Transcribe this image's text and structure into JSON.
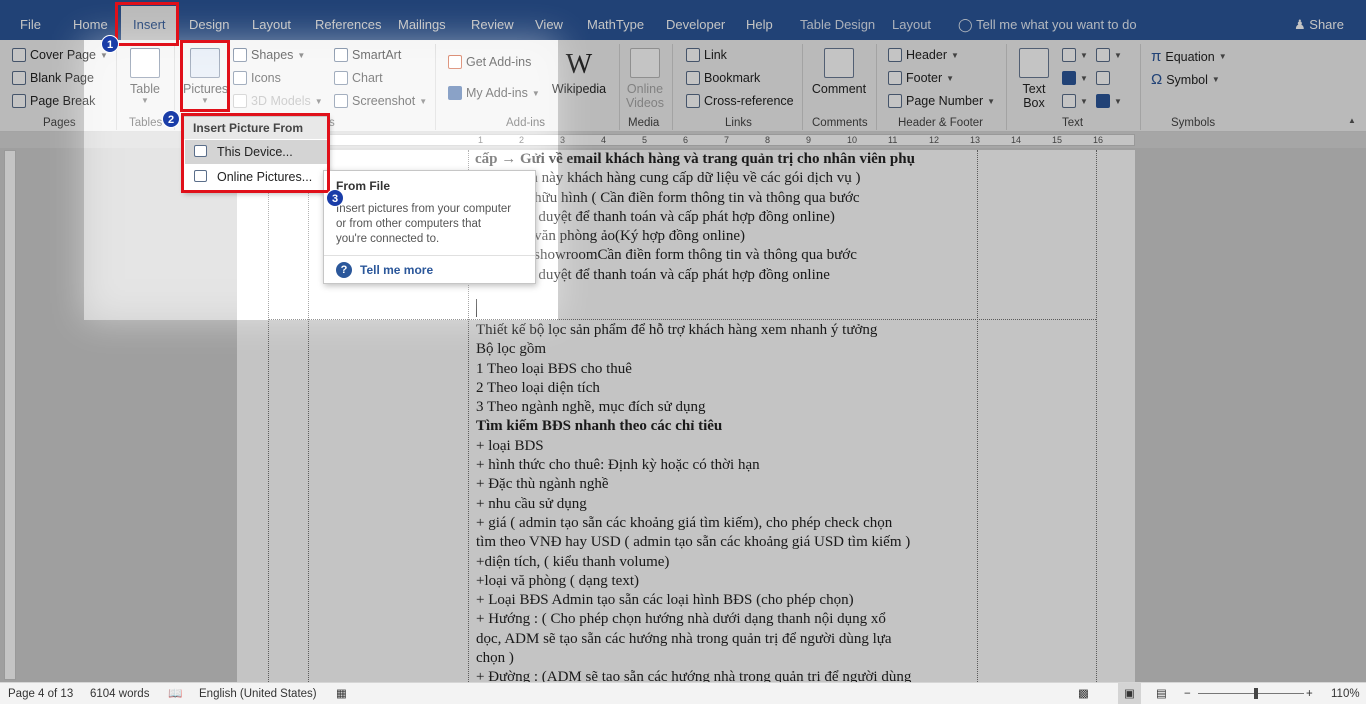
{
  "tabs": [
    "File",
    "Home",
    "Insert",
    "Design",
    "Layout",
    "References",
    "Mailings",
    "Review",
    "View",
    "MathType",
    "Developer",
    "Help",
    "Table Design",
    "Layout"
  ],
  "tell_me": "Tell me what you want to do",
  "share": "Share",
  "ribbon": {
    "pages": {
      "label": "Pages",
      "cover_page": "Cover Page",
      "blank_page": "Blank Page",
      "page_break": "Page Break"
    },
    "tables": {
      "label": "Tables",
      "table": "Table"
    },
    "illustrations": {
      "label_fragment": "s",
      "pictures": "Pictures",
      "shapes": "Shapes",
      "icons": "Icons",
      "models_3d": "3D Models",
      "smartart": "SmartArt",
      "chart": "Chart",
      "screenshot": "Screenshot"
    },
    "addins": {
      "label": "Add-ins",
      "get_addins": "Get Add-ins",
      "my_addins": "My Add-ins",
      "wikipedia": "Wikipedia"
    },
    "media": {
      "label": "Media",
      "online_videos_1": "Online",
      "online_videos_2": "Videos"
    },
    "links": {
      "label": "Links",
      "link": "Link",
      "bookmark": "Bookmark",
      "cross_reference": "Cross-reference"
    },
    "comments": {
      "label": "Comments",
      "comment": "Comment"
    },
    "header_footer": {
      "label": "Header & Footer",
      "header": "Header",
      "footer": "Footer",
      "page_number": "Page Number"
    },
    "text": {
      "label": "Text",
      "text_box_1": "Text",
      "text_box_2": "Box"
    },
    "symbols": {
      "label": "Symbols",
      "equation": "Equation",
      "symbol": "Symbol"
    }
  },
  "dropdown": {
    "header": "Insert Picture From",
    "this_device": "This Device...",
    "online_pictures": "Online Pictures..."
  },
  "tooltip": {
    "title": "From File",
    "line1": "Insert pictures from your computer",
    "line2": "or from other computers that",
    "line3": "you're connected to.",
    "link": "Tell me more"
  },
  "badges": [
    "1",
    "2",
    "3"
  ],
  "ruler": {
    "marks": [
      "1",
      "2",
      "3",
      "4",
      "5",
      "6",
      "7",
      "8",
      "9",
      "10",
      "11",
      "12",
      "13",
      "14",
      "15",
      "16",
      "17",
      "18",
      "19",
      "20"
    ]
  },
  "document": {
    "cell_top": [
      "cấp → Gửi về email khách hàng và trang quản trị cho nhân viên phụ",
      "trách phần này khách hàng cung cấp dữ liệu về các gói dịch vụ )",
      "Gói BĐS hữu hình  ( Cần điền form thông tin và thông qua bước",
      "admin xét duyệt để thanh toán và cấp phát hợp đồng online)",
      "Gói BĐS văn phòng ảo(Ký hợp đồng online)",
      "Gói BĐS showroomCần điền form thông tin và thông qua bước",
      "admin xét duyệt để thanh toán và cấp phát hợp đồng online"
    ],
    "cell_main": [
      "Thiết kế bộ lọc sản phẩm để hỗ trợ khách hàng xem nhanh ý tưởng",
      "Bộ lọc gồm",
      "1 Theo loại BĐS cho thuê",
      "2 Theo loại diện tích",
      "3 Theo ngành nghề, mục đích sử dụng",
      "Tìm kiếm BĐS nhanh theo các chỉ tiêu",
      "+ loại BDS",
      "+ hình thức cho thuê: Định kỳ hoặc có thời hạn",
      "+ Đặc thù ngành nghề",
      "+ nhu cầu sử dụng",
      "+ giá ( admin tạo sẵn các khoảng giá tìm kiếm), cho phép check chọn",
      "tìm theo VNĐ hay USD ( admin tạo sẵn các khoảng giá USD tìm kiếm )",
      "+diện tích, ( kiểu thanh volume)",
      "+loại vă phòng ( dạng text)",
      "+ Loại BĐS Admin tạo sẵn các loại hình BĐS (cho phép  chọn)",
      "+ Hướng : ( Cho phép chọn hướng nhà dưới dạng thanh nội dụng xổ",
      "dọc, ADM sẽ tạo sẵn các hướng nhà trong quản trị để người dùng lựa",
      "chọn )",
      "+ Đường : (ADM sẽ tạo sẵn các hướng nhà trong quản trị để người dùng"
    ]
  },
  "status": {
    "page": "Page 4 of 13",
    "words": "6104 words",
    "language": "English (United States)",
    "zoom": "110%"
  }
}
